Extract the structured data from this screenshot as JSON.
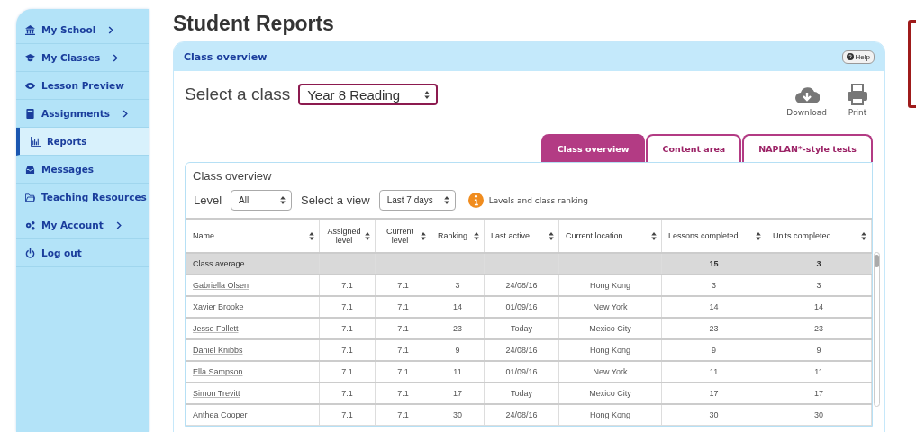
{
  "sidebar": {
    "items": [
      {
        "label": "My School",
        "has_submenu": true,
        "selected": false
      },
      {
        "label": "My Classes",
        "has_submenu": true,
        "selected": false
      },
      {
        "label": "Lesson Preview",
        "has_submenu": false,
        "selected": false
      },
      {
        "label": "Assignments",
        "has_submenu": true,
        "selected": false
      },
      {
        "label": "Reports",
        "has_submenu": false,
        "selected": true
      },
      {
        "label": "Messages",
        "has_submenu": false,
        "selected": false
      },
      {
        "label": "Teaching Resources",
        "has_submenu": false,
        "selected": false
      },
      {
        "label": "My Account",
        "has_submenu": true,
        "selected": false
      },
      {
        "label": "Log out",
        "has_submenu": false,
        "selected": false
      }
    ]
  },
  "page_title": "Student Reports",
  "panel": {
    "title": "Class overview",
    "help": "Help",
    "class_select": {
      "label": "Select a class",
      "value": "Year 8 Reading"
    },
    "actions": [
      {
        "kind": "download",
        "label": "Download"
      },
      {
        "kind": "print",
        "label": "Print"
      }
    ],
    "tabs": [
      {
        "label": "Class overview",
        "selected": true
      },
      {
        "label": "Content area",
        "selected": false
      },
      {
        "label": "NAPLAN*-style tests",
        "selected": false
      }
    ],
    "section_title": "Class overview",
    "filters": [
      {
        "label": "Level",
        "value": "All"
      },
      {
        "label": "Select a view",
        "value": "Last 7 days"
      }
    ],
    "info_link": "Levels and class ranking",
    "table": {
      "columns": [
        "Name",
        "Assigned level",
        "Current level",
        "Ranking",
        "Last active",
        "Current location",
        "Lessons completed",
        "Units completed"
      ],
      "rows": [
        {
          "kind": "average",
          "cells": [
            "Class average",
            "",
            "",
            "",
            "",
            "",
            "15",
            "3"
          ]
        },
        {
          "kind": "student",
          "cells": [
            "Gabriella Olsen",
            "7.1",
            "7.1",
            "3",
            "24/08/16",
            "Hong Kong",
            "3",
            "3"
          ]
        },
        {
          "kind": "student",
          "cells": [
            "Xavier Brooke",
            "7.1",
            "7.1",
            "14",
            "01/09/16",
            "New York",
            "14",
            "14"
          ]
        },
        {
          "kind": "student",
          "cells": [
            "Jesse Follett",
            "7.1",
            "7.1",
            "23",
            "Today",
            "Mexico City",
            "23",
            "23"
          ]
        },
        {
          "kind": "student",
          "cells": [
            "Daniel Knibbs",
            "7.1",
            "7.1",
            "9",
            "24/08/16",
            "Hong Kong",
            "9",
            "9"
          ]
        },
        {
          "kind": "student",
          "cells": [
            "Ella Sampson",
            "7.1",
            "7.1",
            "11",
            "01/09/16",
            "New York",
            "11",
            "11"
          ]
        },
        {
          "kind": "student",
          "cells": [
            "Simon Trevitt",
            "7.1",
            "7.1",
            "17",
            "Today",
            "Mexico City",
            "17",
            "17"
          ]
        },
        {
          "kind": "student",
          "cells": [
            "Anthea Cooper",
            "7.1",
            "7.1",
            "30",
            "24/08/16",
            "Hong Kong",
            "30",
            "30"
          ]
        }
      ]
    }
  }
}
